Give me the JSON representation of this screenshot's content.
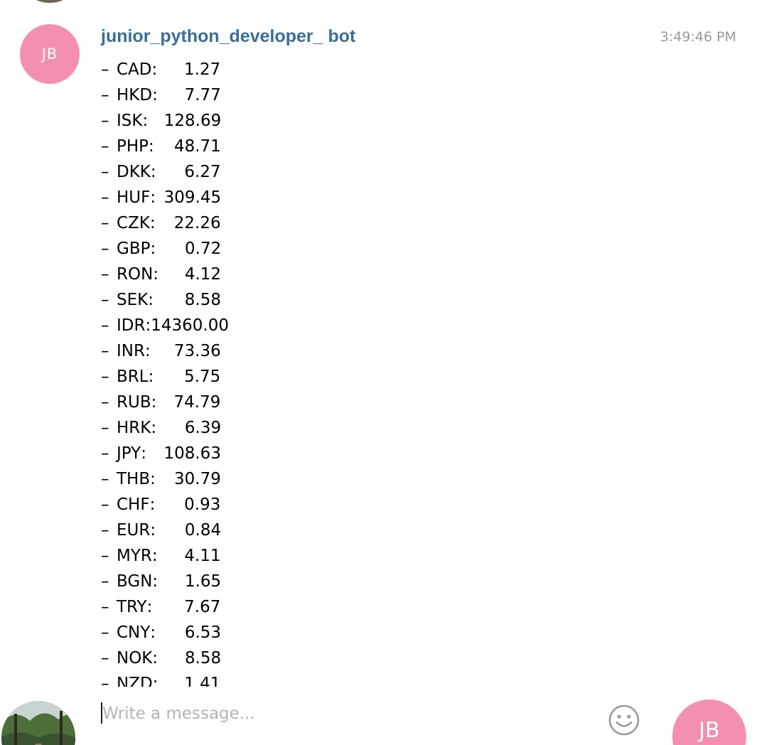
{
  "message": {
    "avatar_initials": "JB",
    "sender": "junior_python_developer_ bot",
    "time": "3:49:46 PM",
    "rates": [
      {
        "code": "CAD",
        "value": "1.27"
      },
      {
        "code": "HKD",
        "value": "7.77"
      },
      {
        "code": "ISK",
        "value": "128.69"
      },
      {
        "code": "PHP",
        "value": "48.71"
      },
      {
        "code": "DKK",
        "value": "6.27"
      },
      {
        "code": "HUF",
        "value": "309.45"
      },
      {
        "code": "CZK",
        "value": "22.26"
      },
      {
        "code": "GBP",
        "value": "0.72"
      },
      {
        "code": "RON",
        "value": "4.12"
      },
      {
        "code": "SEK",
        "value": "8.58"
      },
      {
        "code": "IDR",
        "value": "14360.00"
      },
      {
        "code": "INR",
        "value": "73.36"
      },
      {
        "code": "BRL",
        "value": "5.75"
      },
      {
        "code": "RUB",
        "value": "74.79"
      },
      {
        "code": "HRK",
        "value": "6.39"
      },
      {
        "code": "JPY",
        "value": "108.63"
      },
      {
        "code": "THB",
        "value": "30.79"
      },
      {
        "code": "CHF",
        "value": "0.93"
      },
      {
        "code": "EUR",
        "value": "0.84"
      },
      {
        "code": "MYR",
        "value": "4.11"
      },
      {
        "code": "BGN",
        "value": "1.65"
      },
      {
        "code": "TRY",
        "value": "7.67"
      },
      {
        "code": "CNY",
        "value": "6.53"
      },
      {
        "code": "NOK",
        "value": "8.58"
      },
      {
        "code": "NZD",
        "value": "1.41"
      }
    ]
  },
  "composer": {
    "placeholder": "Write a message...",
    "emoji_icon": "smile-icon",
    "bot_avatar_initials": "JB"
  },
  "colors": {
    "avatar_bg": "#f58fb2",
    "sender_name": "#3a6d99",
    "timestamp": "#9a9a9a",
    "placeholder": "#b3b3b3"
  }
}
